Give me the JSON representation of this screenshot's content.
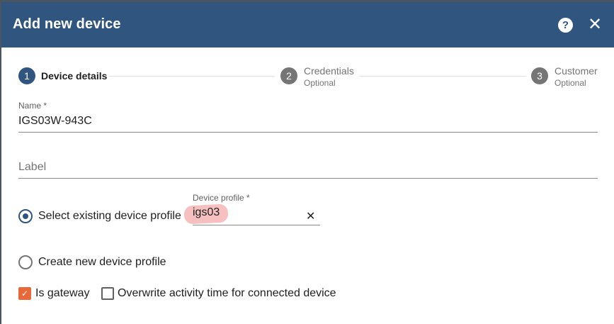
{
  "dialog": {
    "title": "Add new device",
    "help_icon": "help-icon",
    "close_icon": "close-icon"
  },
  "stepper": {
    "steps": [
      {
        "number": "1",
        "label": "Device details",
        "sublabel": ""
      },
      {
        "number": "2",
        "label": "Credentials",
        "sublabel": "Optional"
      },
      {
        "number": "3",
        "label": "Customer",
        "sublabel": "Optional"
      }
    ]
  },
  "form": {
    "name": {
      "label": "Name *",
      "value": "IGS03W-943C"
    },
    "label": {
      "placeholder": "Label"
    },
    "profile_option": {
      "existing_label": "Select existing device profile",
      "new_label": "Create new device profile",
      "selected": "existing"
    },
    "device_profile": {
      "label": "Device profile *",
      "value": "igs03",
      "clear_icon": "clear-icon"
    },
    "is_gateway": {
      "label": "Is gateway",
      "checked": true
    },
    "overwrite_activity": {
      "label": "Overwrite activity time for connected device",
      "checked": false
    }
  },
  "colors": {
    "header": "#305680",
    "accent": "#305680",
    "checkbox_accent": "#e8683a",
    "annotation_highlight": "#f6b9b9"
  }
}
